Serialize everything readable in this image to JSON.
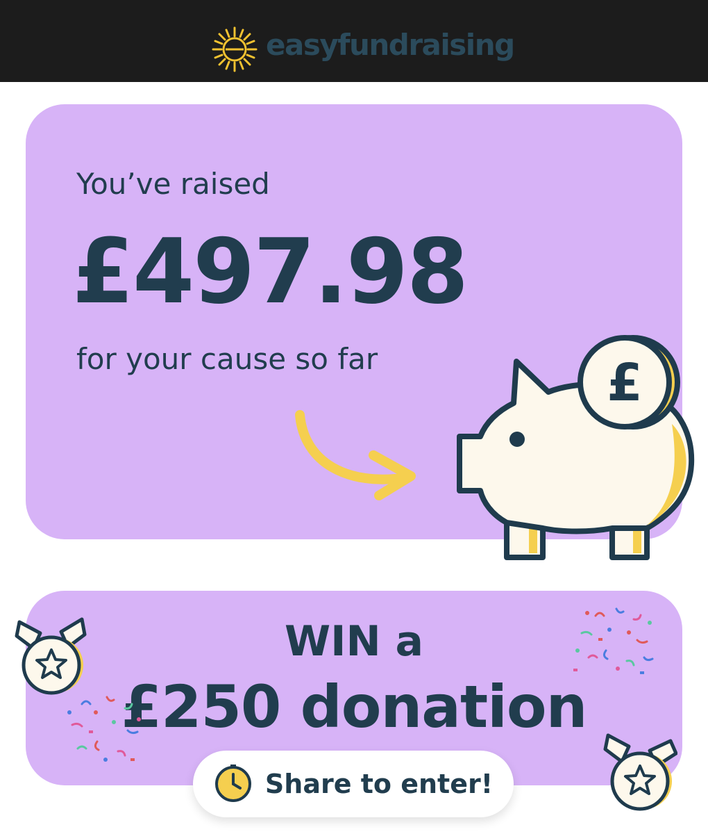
{
  "header": {
    "brand": "easyfundraising"
  },
  "raised": {
    "prefix": "You’ve raised",
    "amount": "£497.98",
    "suffix": "for your cause so far"
  },
  "piggy": {
    "coin_symbol": "£"
  },
  "promo": {
    "line1": "WIN a",
    "line2": "£250 donation",
    "cta_label": "Share to enter!"
  },
  "colors": {
    "card": "#d7b3f7",
    "text": "#213d4e",
    "accent_yellow": "#f5cf4f",
    "topbar": "#1c1c1c"
  },
  "icons": [
    "sunburst-logo-icon",
    "arrow-icon",
    "piggy-bank-icon",
    "medal-star-icon",
    "confetti-icon",
    "clock-icon"
  ]
}
